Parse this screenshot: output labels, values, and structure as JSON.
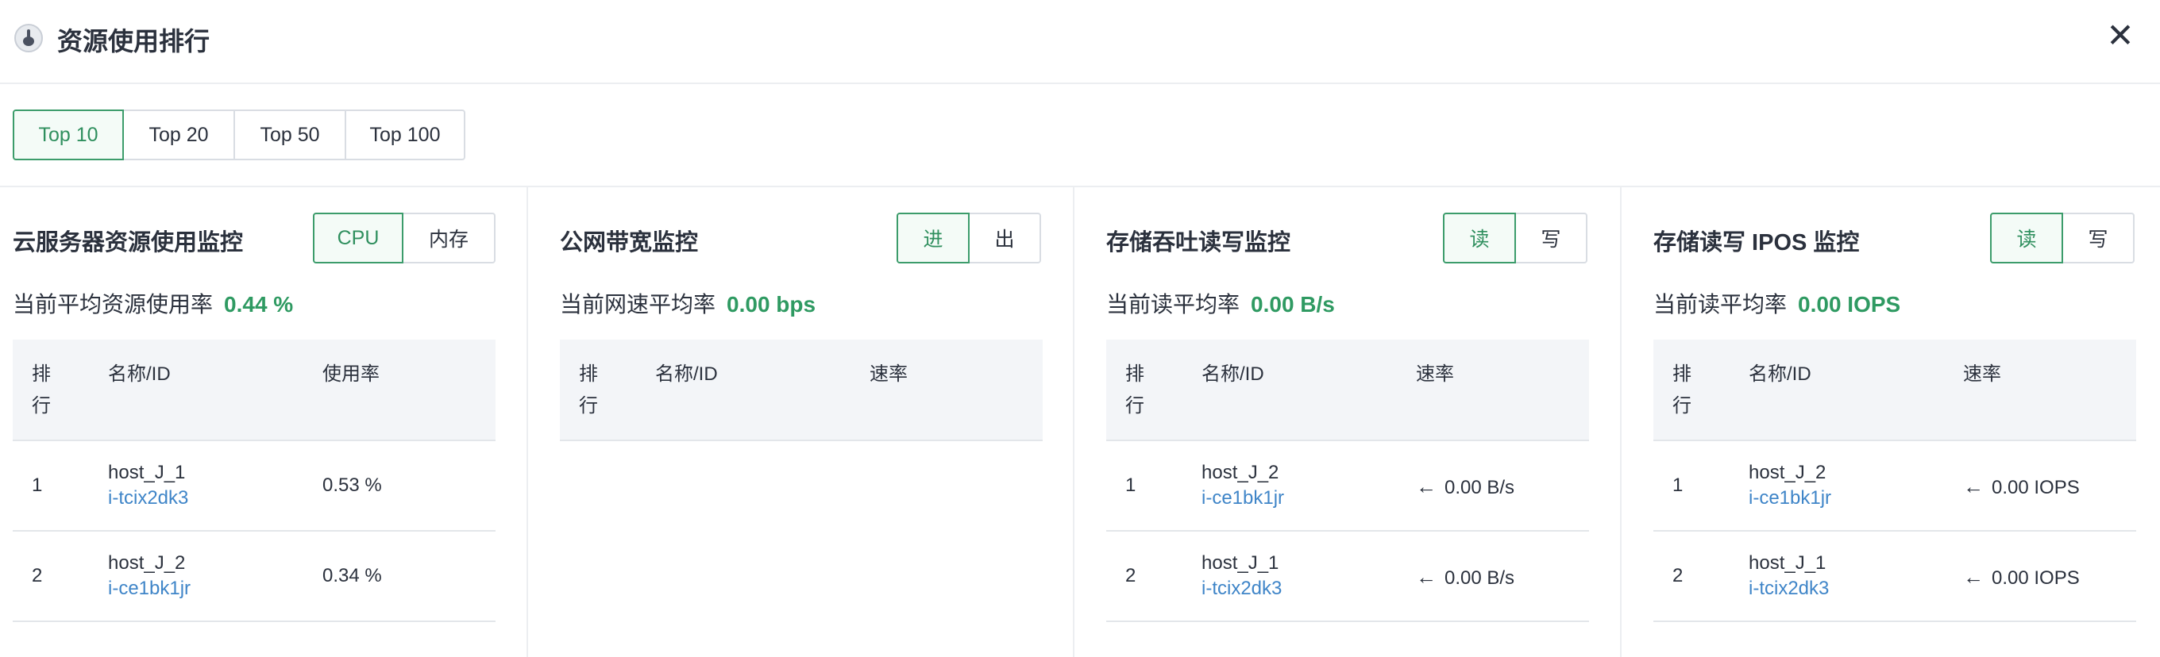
{
  "header": {
    "title": "资源使用排行",
    "logo_icon": "resource-logo-icon",
    "close_icon": "close-icon",
    "close_glyph": "✕"
  },
  "top_tabs": {
    "items": [
      {
        "label": "Top 10",
        "active": true
      },
      {
        "label": "Top 20",
        "active": false
      },
      {
        "label": "Top 50",
        "active": false
      },
      {
        "label": "Top 100",
        "active": false
      }
    ]
  },
  "colors": {
    "accent_green": "#2f9a62",
    "link_blue": "#3f85c8",
    "border": "#d9dde3",
    "table_header_bg": "#f3f5f8"
  },
  "panels": [
    {
      "title": "云服务器资源使用监控",
      "toggle": [
        {
          "label": "CPU",
          "active": true
        },
        {
          "label": "内存",
          "active": false
        }
      ],
      "avg_label": "当前平均资源使用率",
      "avg_value": "0.44 %",
      "columns": {
        "rank": "排行",
        "name": "名称/ID",
        "value": "使用率"
      },
      "rows": [
        {
          "rank": "1",
          "name": "host_J_1",
          "id": "i-tcix2dk3",
          "value": "0.53 %",
          "arrow": ""
        },
        {
          "rank": "2",
          "name": "host_J_2",
          "id": "i-ce1bk1jr",
          "value": "0.34 %",
          "arrow": ""
        }
      ]
    },
    {
      "title": "公网带宽监控",
      "toggle": [
        {
          "label": "进",
          "active": true
        },
        {
          "label": "出",
          "active": false
        }
      ],
      "avg_label": "当前网速平均率",
      "avg_value": "0.00 bps",
      "columns": {
        "rank": "排行",
        "name": "名称/ID",
        "value": "速率"
      },
      "rows": []
    },
    {
      "title": "存储吞吐读写监控",
      "toggle": [
        {
          "label": "读",
          "active": true
        },
        {
          "label": "写",
          "active": false
        }
      ],
      "avg_label": "当前读平均率",
      "avg_value": "0.00 B/s",
      "columns": {
        "rank": "排行",
        "name": "名称/ID",
        "value": "速率"
      },
      "rows": [
        {
          "rank": "1",
          "name": "host_J_2",
          "id": "i-ce1bk1jr",
          "value": "0.00 B/s",
          "arrow": "←"
        },
        {
          "rank": "2",
          "name": "host_J_1",
          "id": "i-tcix2dk3",
          "value": "0.00 B/s",
          "arrow": "←"
        }
      ]
    },
    {
      "title": "存储读写 IPOS 监控",
      "toggle": [
        {
          "label": "读",
          "active": true
        },
        {
          "label": "写",
          "active": false
        }
      ],
      "avg_label": "当前读平均率",
      "avg_value": "0.00 IOPS",
      "columns": {
        "rank": "排行",
        "name": "名称/ID",
        "value": "速率"
      },
      "rows": [
        {
          "rank": "1",
          "name": "host_J_2",
          "id": "i-ce1bk1jr",
          "value": "0.00 IOPS",
          "arrow": "←"
        },
        {
          "rank": "2",
          "name": "host_J_1",
          "id": "i-tcix2dk3",
          "value": "0.00 IOPS",
          "arrow": "←"
        }
      ]
    }
  ]
}
